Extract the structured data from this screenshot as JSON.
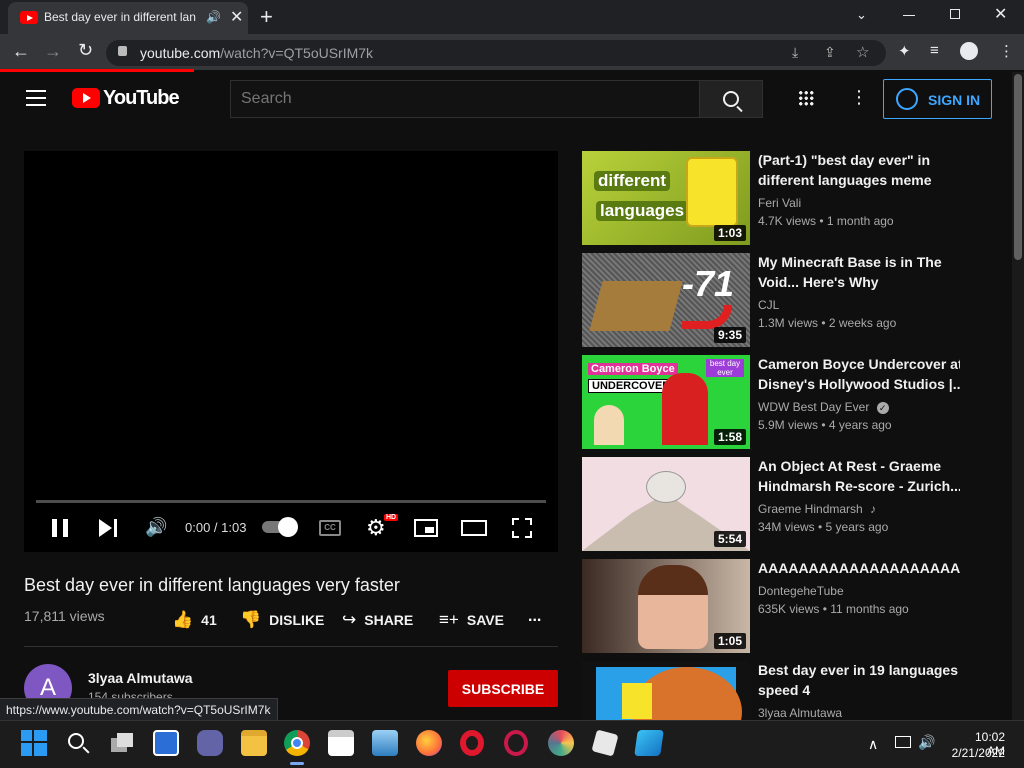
{
  "browser": {
    "tab_title": "Best day ever in different lan",
    "new_tab": "+",
    "url_host": "youtube.com",
    "url_path": "/watch?v=QT5oUSrIM7k",
    "status_url": "https://www.youtube.com/watch?v=QT5oUSrIM7k"
  },
  "yt": {
    "logo": "YouTube",
    "search_placeholder": "Search",
    "sign_in": "SIGN IN"
  },
  "player": {
    "time": "0:00 / 1:03",
    "hd_badge": "HD",
    "progress": 0
  },
  "video": {
    "title": "Best day ever in different languages very faster",
    "views": "17,811 views",
    "likes": "41",
    "dislike": "DISLIKE",
    "share": "SHARE",
    "save": "SAVE",
    "more": "..."
  },
  "channel": {
    "avatar_letter": "A",
    "name": "3lyaa Almutawa",
    "subs": "154 subscribers",
    "subscribe": "SUBSCRIBE"
  },
  "recommended": [
    {
      "title1": "(Part-1) \"best day ever\" in",
      "title2": "different languages meme",
      "channel": "Feri Vali",
      "meta": "4.7K views • 1 month ago",
      "duration": "1:03",
      "thumb_text1": "different",
      "thumb_text2": "languages"
    },
    {
      "title1": "My Minecraft Base is in The",
      "title2": "Void... Here's Why",
      "channel": "CJL",
      "meta": "1.3M views • 2 weeks ago",
      "duration": "9:35",
      "thumb_text1": "-71"
    },
    {
      "title1": "Cameron Boyce Undercover at",
      "title2": "Disney's Hollywood Studios |...",
      "channel": "WDW Best Day Ever",
      "meta": "5.9M views • 4 years ago",
      "duration": "1:58",
      "thumb_text1": "Cameron Boyce",
      "thumb_text2": "UNDERCOVER",
      "thumb_text3": "best day ever"
    },
    {
      "title1": "An Object At Rest - Graeme",
      "title2": "Hindmarsh Re-score - Zurich...",
      "channel": "Graeme Hindmarsh",
      "meta": "34M views • 5 years ago",
      "duration": "5:54"
    },
    {
      "title1": "AAAAAAAAAAAAAAAAAAAAA",
      "channel": "DontegeheTube",
      "meta": "635K views • 11 months ago",
      "duration": "1:05"
    },
    {
      "title1": "Best day ever in 19 languages",
      "title2": "speed 4",
      "channel": "3lyaa Almutawa"
    }
  ],
  "taskbar": {
    "time": "10:02 AM",
    "date": "2/21/2022"
  }
}
